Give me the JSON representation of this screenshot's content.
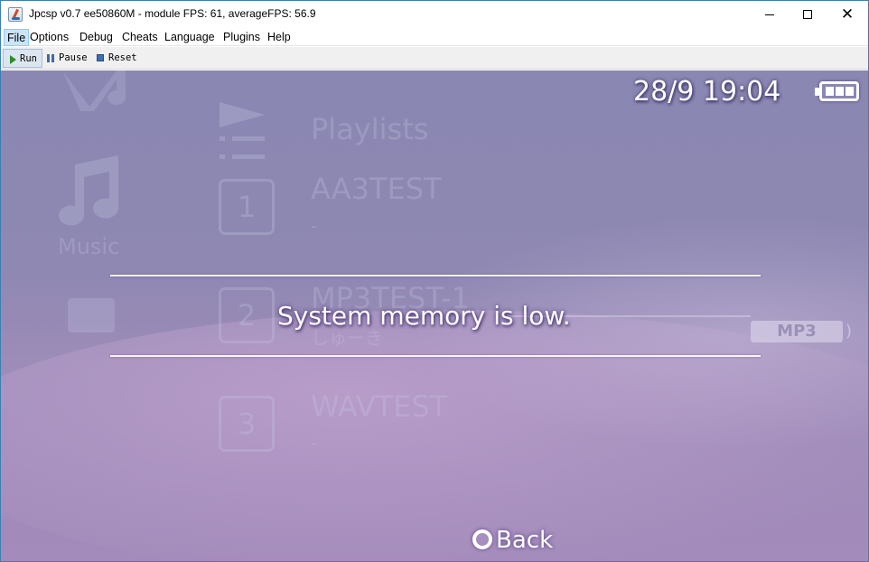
{
  "window": {
    "title": "Jpcsp v0.7 ee50860M - module FPS: 61, averageFPS: 56.9",
    "controls": {
      "minimize": "minimize-icon",
      "maximize": "maximize-icon",
      "close": "✕"
    }
  },
  "menubar": {
    "items": [
      {
        "label": "File",
        "active": true
      },
      {
        "label": "Options"
      },
      {
        "label": "Debug"
      },
      {
        "label": "Cheats"
      },
      {
        "label": "Language"
      },
      {
        "label": "Plugins"
      },
      {
        "label": "Help"
      }
    ]
  },
  "toolbar": {
    "run_label": "Run",
    "pause_label": "Pause",
    "reset_label": "Reset",
    "run_selected": true
  },
  "screen": {
    "clock": "28/9 19:04",
    "battery_bars": 3,
    "background": {
      "sidebar_label": "Music",
      "playlists_label": "Playlists",
      "tracks": [
        {
          "number": "1",
          "title": "AA3TEST",
          "subtitle": "-"
        },
        {
          "number": "2",
          "title": "MP3TEST-1",
          "subtitle": "しゅーき"
        },
        {
          "number": "3",
          "title": "WAVTEST",
          "subtitle": "-"
        }
      ],
      "format_badge": "MP3"
    },
    "dialog": {
      "message": "System memory is low."
    },
    "back_label": "Back"
  },
  "colors": {
    "screen_top": "#8a87b3",
    "screen_bottom": "#a38bbb",
    "menu_active_bg": "#cce4f7",
    "window_border": "#3c7fb1"
  }
}
